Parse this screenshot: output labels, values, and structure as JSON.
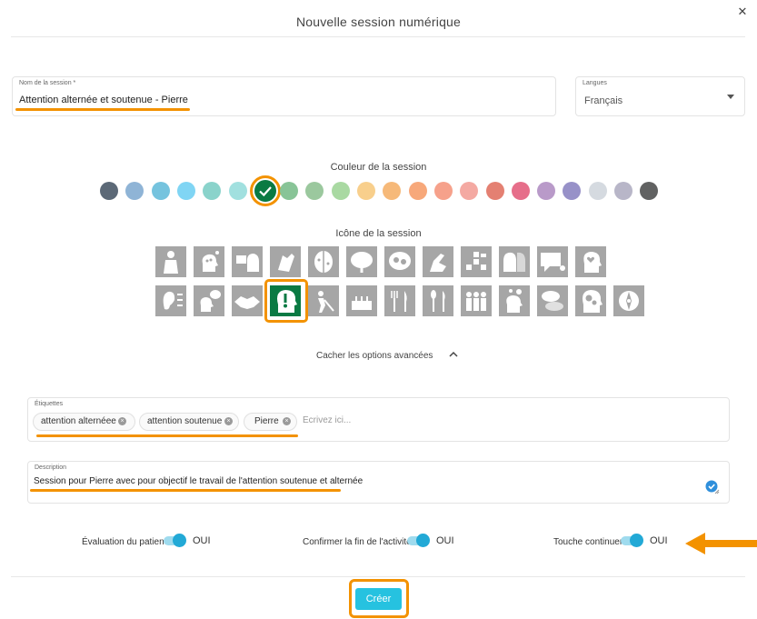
{
  "modal": {
    "title": "Nouvelle session numérique"
  },
  "session_name": {
    "label": "Nom de la session *",
    "value": "Attention alternée et soutenue - Pierre"
  },
  "language": {
    "label": "Langues",
    "value": "Français"
  },
  "color_section": {
    "caption": "Couleur de la session",
    "swatches": [
      "#5c6977",
      "#8fb4d6",
      "#75c3de",
      "#80d5f4",
      "#8ad3cb",
      "#a1e0df",
      "#0a7a43",
      "#88c497",
      "#9bc89e",
      "#a9d9a2",
      "#f8cf8c",
      "#f6b979",
      "#f7a87a",
      "#f6a18b",
      "#f4a9a2",
      "#e48072",
      "#e66e8a",
      "#b99ac9",
      "#9791c8",
      "#d5dae0",
      "#b8b6c8",
      "#616262"
    ],
    "selected_index": 6
  },
  "icon_section": {
    "caption": "Icône de la session",
    "row1": [
      "body-anatomy-icon",
      "head-dots-icon",
      "speaking-picture-icon",
      "clapping-hands-icon",
      "brain-halves-icon",
      "brain-side-icon",
      "brain-gears-icon",
      "hand-pointing-icon",
      "blocks-puzzle-icon",
      "two-heads-icon",
      "speech-board-icon",
      "head-heart-icon"
    ],
    "row2": [
      "ear-sound-icon",
      "head-bubble-icon",
      "handshake-icon",
      "head-exclamation-icon",
      "person-shovel-icon",
      "cake-birthday-icon",
      "fork-knife-icon",
      "spoon-knife-icon",
      "family-people-icon",
      "head-idea-icon",
      "dialog-bubbles-icon",
      "head-gears-icon",
      "compass-icon"
    ],
    "selected": "head-exclamation-icon"
  },
  "advanced": {
    "label": "Cacher les options avancées"
  },
  "tags": {
    "label": "Étiquettes",
    "items": [
      "attention alternéee",
      "attention soutenue",
      "Pierre"
    ],
    "placeholder": "Écrivez ici..."
  },
  "description": {
    "label": "Description",
    "value": "Session pour Pierre avec pour objectif le travail de l'attention soutenue et alternée"
  },
  "toggles": [
    {
      "label": "Évaluation du patient",
      "value": "OUI",
      "on": true
    },
    {
      "label": "Confirmer la fin de l'activité",
      "value": "OUI",
      "on": true
    },
    {
      "label": "Touche continuer",
      "value": "OUI",
      "on": true
    }
  ],
  "actions": {
    "create_label": "Créer"
  },
  "highlight": {
    "color": "#f39200"
  }
}
